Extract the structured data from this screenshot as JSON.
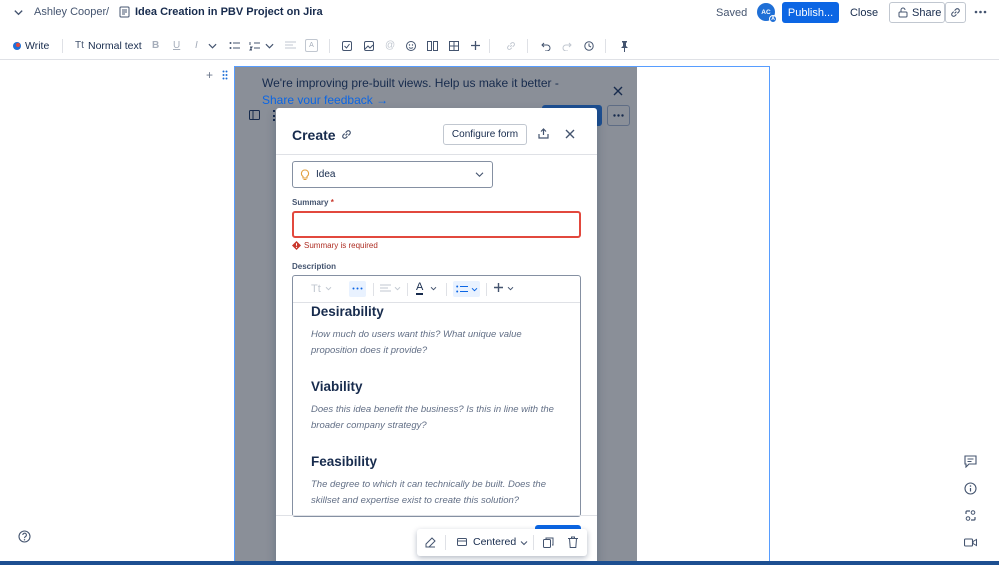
{
  "header": {
    "breadcrumb_user": "Ashley Cooper",
    "separator": "/",
    "page_title": "Idea Creation in PBV Project on Jira",
    "saved": "Saved",
    "avatar_initials": "AC",
    "publish_label": "Publish...",
    "close_label": "Close",
    "share_label": "Share"
  },
  "toolbar": {
    "write_label": "Write",
    "text_style_label": "Normal text",
    "text_style_prefix": "Tt"
  },
  "banner": {
    "text": "We're improving pre-built views. Help us make it better -",
    "link": "Share your feedback →"
  },
  "modal": {
    "title": "Create",
    "configure_label": "Configure form",
    "type_value": "Idea",
    "summary_label": "Summary",
    "required_mark": "*",
    "summary_value": "",
    "summary_error": "Summary is required",
    "description_label": "Description",
    "editor_toolbar": {
      "text_style": "Tt"
    },
    "sections": [
      {
        "heading": "Desirability",
        "body": "How much do users want this? What unique value proposition does it provide?"
      },
      {
        "heading": "Viability",
        "body": "Does this idea benefit the business? Is this in line with the broader company strategy?"
      },
      {
        "heading": "Feasibility",
        "body": "The degree to which it can technically be built. Does the skillset and expertise exist to create this solution?"
      }
    ]
  },
  "floatbar": {
    "layout_label": "Centered"
  },
  "colors": {
    "primary": "#0c66e4",
    "error": "#e2483d",
    "frame_border": "#579dff",
    "overlay": "#8a8f98"
  },
  "icons": [
    "chevron-down-icon",
    "page-icon",
    "lock-icon",
    "link-icon",
    "more-icon",
    "pen-icon",
    "bold-icon",
    "underline-icon",
    "italic-icon",
    "bullet-list-icon",
    "numbered-list-icon",
    "align-icon",
    "text-color-icon",
    "checkbox-icon",
    "image-icon",
    "mention-icon",
    "emoji-icon",
    "columns-icon",
    "table-icon",
    "plus-icon",
    "undo-icon",
    "redo-icon",
    "history-icon",
    "pin-icon",
    "bulb-icon",
    "share-icon",
    "close-icon",
    "warning-icon",
    "edit-icon",
    "layout-icon",
    "copy-icon",
    "trash-icon",
    "comment-icon",
    "info-icon",
    "loop-icon",
    "video-icon",
    "help-icon",
    "drag-handle-icon",
    "sidebar-icon"
  ]
}
